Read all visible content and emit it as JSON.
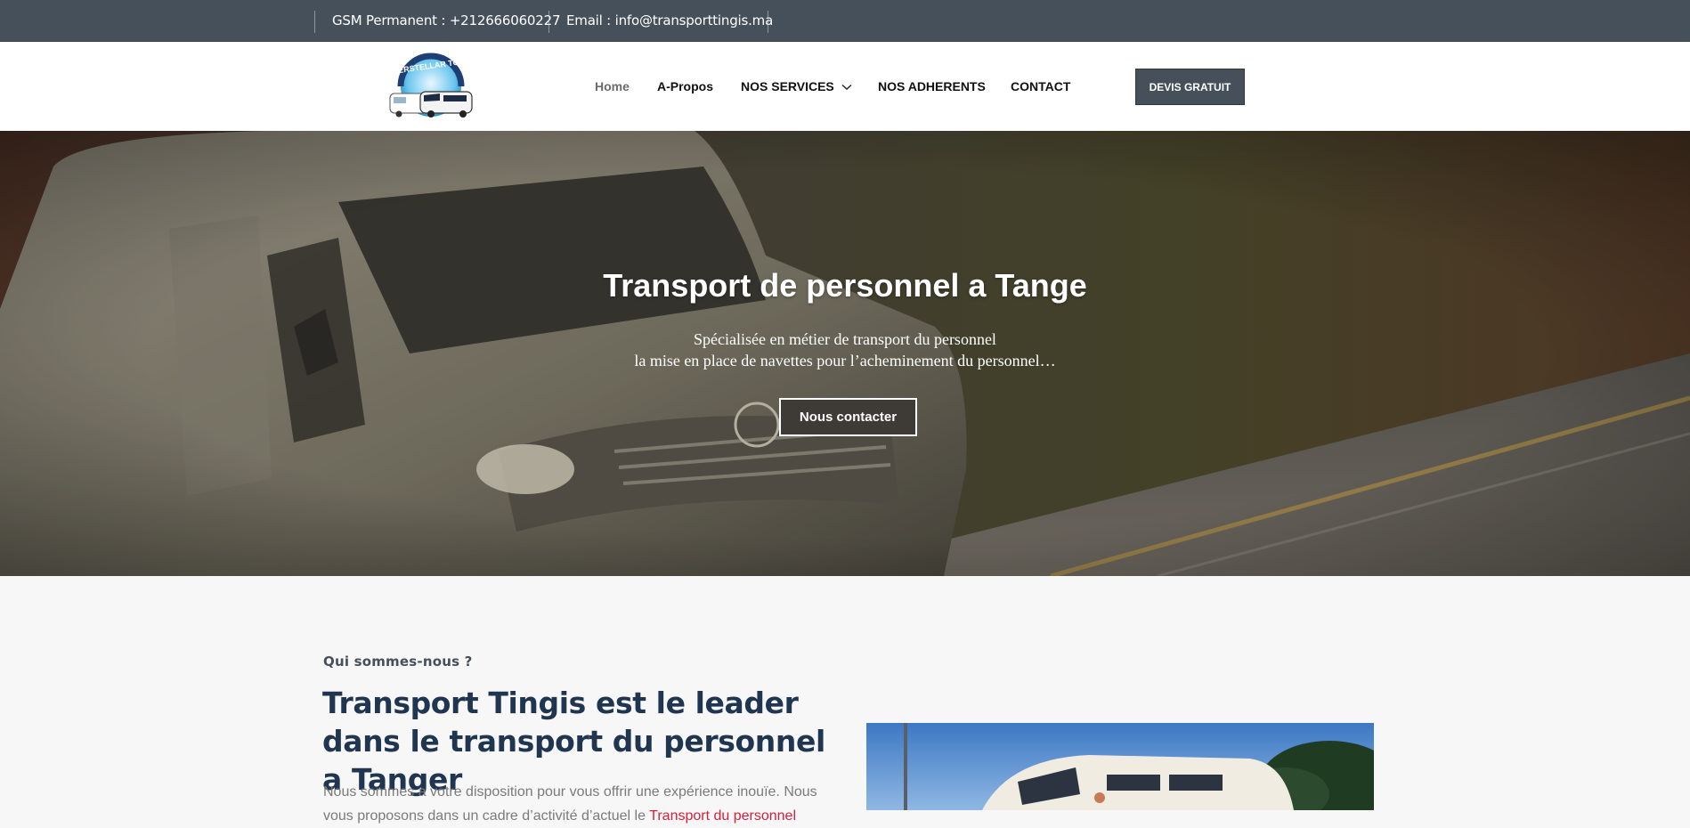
{
  "topbar": {
    "phone": "GSM Permanent : +212666060227",
    "email": "Email : info@transporttingis.ma"
  },
  "header": {
    "logo_text": "INTERSTELLAR TOURS",
    "nav": [
      {
        "label": "Home",
        "active": true
      },
      {
        "label": "A-Propos"
      },
      {
        "label": "NOS SERVICES"
      },
      {
        "label": "NOS ADHERENTS"
      },
      {
        "label": "CONTACT"
      }
    ],
    "cta": "DEVIS GRATUIT"
  },
  "hero": {
    "title": "Transport de personnel a Tange",
    "subtitle_line1": "Spécialisée en métier de transport du personnel",
    "subtitle_line2": "la mise en place de navettes pour l’acheminement du personnel…",
    "button": "Nous contacter"
  },
  "about": {
    "kicker": "Qui sommes-nous ?",
    "title": "Transport Tingis est le leader dans le transport du personnel a Tanger",
    "text_start": "Nous sommes a votre disposition pour vous offrir une expérience inouïe. Nous",
    "text_cut": "vous proposons dans un cadre d’activité d’actuel le",
    "text_link": "Transport du personnel"
  },
  "colors": {
    "topbar_bg": "#45505a",
    "cta_bg": "#45505a",
    "title_color": "#1f3550",
    "link_color": "#d81f3a"
  }
}
